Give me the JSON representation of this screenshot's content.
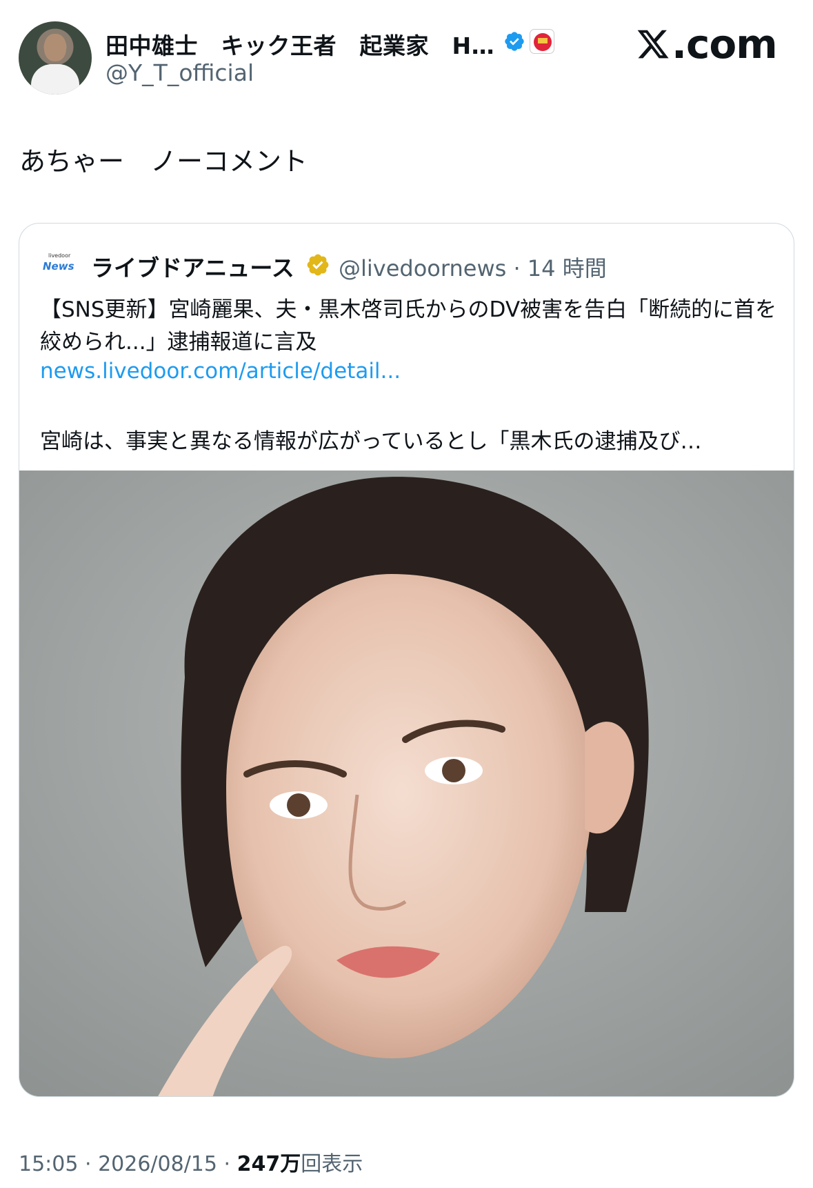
{
  "author": {
    "name": "田中雄士　キック王者　起業家　H…",
    "handle": "@Y_T_official"
  },
  "brand": {
    "site": ".com",
    "icon": "x-logo-icon"
  },
  "tweet": {
    "text": "あちゃー　ノーコメント"
  },
  "quoted": {
    "logo_small": "livedoor",
    "logo_big": "News",
    "name": "ライブドアニュース",
    "handle": "@livedoornews",
    "time": "· 14 時間",
    "body": "【SNS更新】宮崎麗果、夫・黒木啓司氏からのDV被害を告白「断続的に首を絞められ...」逮捕報道に言及",
    "link": "news.livedoor.com/article/detail...",
    "excerpt": "宮崎は、事実と異なる情報が広がっているとし「黒木氏の逮捕及び…"
  },
  "footer": {
    "time": "15:05 · 2026/08/15 · ",
    "views_count": "247万",
    "views_label": "回表示"
  },
  "colors": {
    "verified_blue": "#1d9bf0",
    "verified_gold": "#e2b719",
    "link": "#1d9bf0",
    "secondary_text": "#536471"
  }
}
